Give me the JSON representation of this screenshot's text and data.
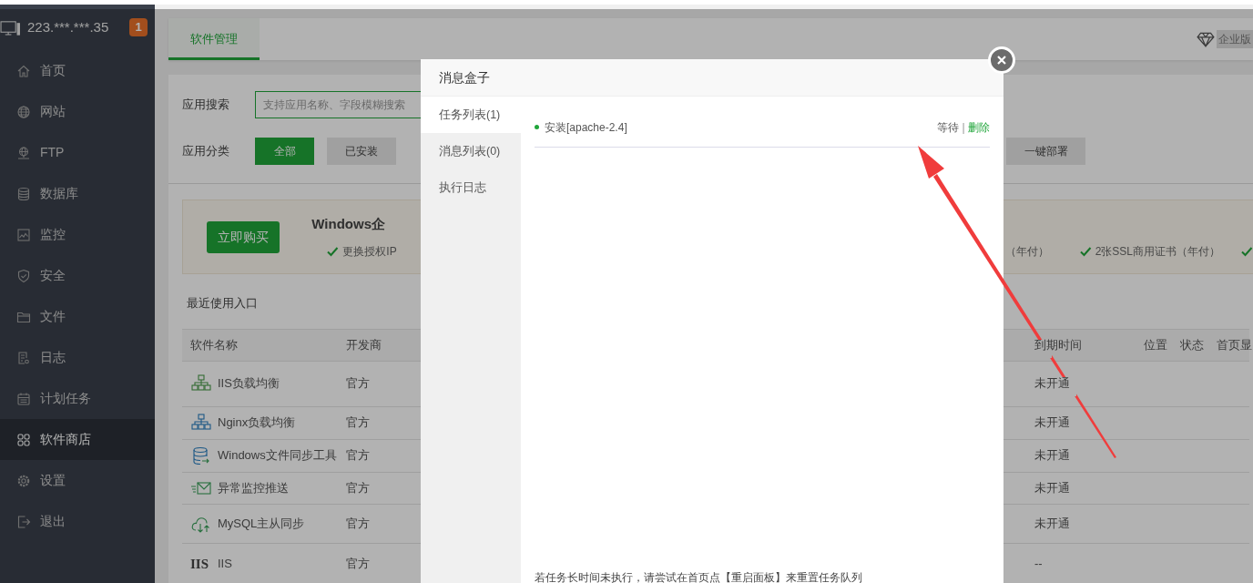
{
  "sidebar": {
    "server": "223.***.***.35",
    "badge": "1",
    "items": [
      {
        "label": "首页",
        "kind": "home",
        "selected": false
      },
      {
        "label": "网站",
        "kind": "globe",
        "selected": false
      },
      {
        "label": "FTP",
        "kind": "ftp",
        "selected": false
      },
      {
        "label": "数据库",
        "kind": "database",
        "selected": false
      },
      {
        "label": "监控",
        "kind": "monitor",
        "selected": false
      },
      {
        "label": "安全",
        "kind": "shield",
        "selected": false
      },
      {
        "label": "文件",
        "kind": "folder",
        "selected": false
      },
      {
        "label": "日志",
        "kind": "log",
        "selected": false
      },
      {
        "label": "计划任务",
        "kind": "calendar",
        "selected": false
      },
      {
        "label": "软件商店",
        "kind": "grid",
        "selected": true
      },
      {
        "label": "设置",
        "kind": "gear",
        "selected": false
      },
      {
        "label": "退出",
        "kind": "logout",
        "selected": false
      }
    ]
  },
  "tabs": [
    {
      "label": "软件管理",
      "selected": true
    }
  ],
  "edition": "企业版",
  "search": {
    "label": "应用搜索",
    "placeholder": "支持应用名称、字段模糊搜索"
  },
  "categories": {
    "label": "应用分类",
    "buttons": [
      {
        "label": "全部",
        "selected": true
      },
      {
        "label": "已安装",
        "selected": false
      },
      {
        "label": "一键部署",
        "selected": false
      }
    ]
  },
  "promo": {
    "button": "立即购买",
    "title": "Windows企",
    "features": [
      {
        "kind": "check",
        "text": "更换授权IP"
      },
      {
        "kind": "text",
        "text": "（年付）"
      },
      {
        "kind": "check",
        "text": "2张SSL商用证书（年付）"
      },
      {
        "kind": "check-only"
      }
    ]
  },
  "recent": "最近使用入口",
  "table": {
    "columns": [
      "软件名称",
      "开发商",
      "到期时间",
      "位置",
      "状态",
      "首页显"
    ],
    "rows": [
      {
        "kind": "network",
        "name": "IIS负载均衡",
        "developer": "官方",
        "expiry": "未开通"
      },
      {
        "kind": "network-blue",
        "name": "Nginx负载均衡",
        "developer": "官方",
        "expiry": "未开通"
      },
      {
        "kind": "database-sync",
        "name": "Windows文件同步工具",
        "developer": "官方",
        "expiry": "未开通"
      },
      {
        "kind": "mail-send",
        "name": "异常监控推送",
        "developer": "官方",
        "expiry": "未开通"
      },
      {
        "kind": "cloud-sync",
        "name": "MySQL主从同步",
        "developer": "官方",
        "expiry": "未开通"
      },
      {
        "kind": "text",
        "icon_text": "IIS",
        "name": "IIS",
        "developer": "官方",
        "expiry": "--"
      }
    ]
  },
  "modal": {
    "title": "消息盒子",
    "tabs": [
      {
        "label": "任务列表(1)",
        "selected": true
      },
      {
        "label": "消息列表(0)",
        "selected": false
      },
      {
        "label": "执行日志",
        "selected": false
      }
    ],
    "tasks": [
      {
        "name": "安装[apache-2.4]",
        "status": "等待",
        "separator": "|",
        "action": "删除"
      }
    ],
    "note": "若任务长时间未执行，请尝试在首页点【重启面板】来重置任务队列"
  }
}
